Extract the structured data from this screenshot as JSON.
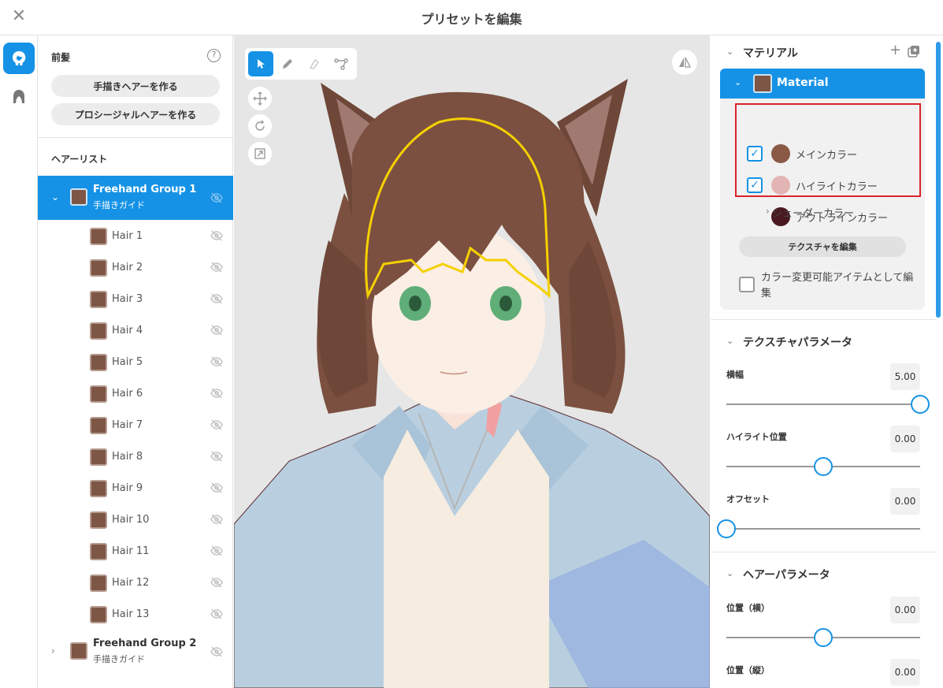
{
  "window": {
    "title": "プリセットを編集",
    "close_glyph": "✕"
  },
  "rail": {
    "items": [
      "hair-front-icon",
      "hair-back-icon"
    ]
  },
  "left_panel": {
    "section_title": "前髪",
    "help_glyph": "?",
    "create_freehand_label": "手描きヘアーを作る",
    "create_procedural_label": "プロシージャルヘアーを作る",
    "list_title": "ヘアーリスト",
    "groups": [
      {
        "name": "Freehand Group 1",
        "sub": "手描きガイド",
        "expanded": true,
        "selected": true
      },
      {
        "name": "Freehand Group 2",
        "sub": "手描きガイド",
        "expanded": false,
        "selected": false
      }
    ],
    "hairs": [
      "Hair 1",
      "Hair 2",
      "Hair 3",
      "Hair 4",
      "Hair 5",
      "Hair 6",
      "Hair 7",
      "Hair 8",
      "Hair 9",
      "Hair 10",
      "Hair 11",
      "Hair 12",
      "Hair 13"
    ],
    "swatch_color": "#7d5645"
  },
  "canvas": {
    "tools": [
      "select-icon",
      "pen-icon",
      "eraser-icon",
      "path-icon"
    ],
    "active_tool": "select-icon",
    "side_tools": [
      "move-icon",
      "rotate-icon",
      "scale-icon"
    ]
  },
  "right_panel": {
    "material_section": {
      "title": "マテリアル",
      "material_name": "Material",
      "colors": [
        {
          "label": "メインカラー",
          "color": "#8a5a46",
          "checked": true
        },
        {
          "label": "ハイライトカラー",
          "color": "#e2b5b4",
          "checked": true
        },
        {
          "label": "アウトラインカラー",
          "color": "#4a1820",
          "checked": false
        }
      ],
      "shader_label": "シェーダーカラー",
      "edit_texture_label": "テクスチャを編集",
      "recolor_label": "カラー変更可能アイテムとして編集"
    },
    "texture_params": {
      "title": "テクスチャパラメータ",
      "params": [
        {
          "label": "横幅",
          "value": "5.00",
          "fraction": 1.0
        },
        {
          "label": "ハイライト位置",
          "value": "0.00",
          "fraction": 0.5
        },
        {
          "label": "オフセット",
          "value": "0.00",
          "fraction": 0.0
        }
      ]
    },
    "hair_params": {
      "title": "ヘアーパラメータ",
      "params": [
        {
          "label": "位置（横）",
          "value": "0.00",
          "fraction": 0.5
        },
        {
          "label": "位置（縦）",
          "value": "0.00",
          "fraction": 0.5
        }
      ]
    },
    "accent_color": "#1592e6"
  }
}
